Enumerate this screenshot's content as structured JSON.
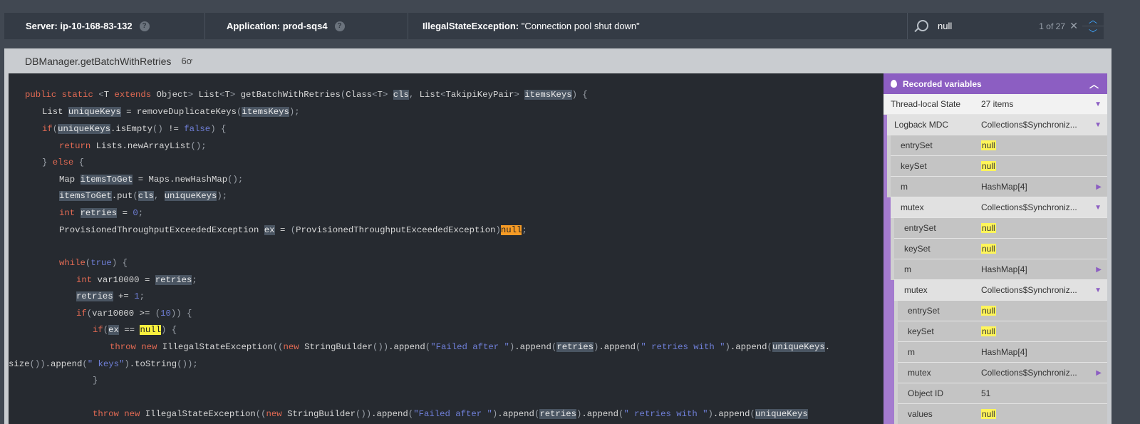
{
  "header": {
    "server": "Server: ip-10-168-83-132",
    "application": "Application: prod-sqs4",
    "exception_type": "IllegalStateException:",
    "exception_message": "\"Connection pool shut down\"",
    "help_glyph": "?",
    "search_value": "null",
    "match_count": "1 of 27",
    "clear_glyph": "✕",
    "prev_glyph": "︿",
    "next_glyph": "﹀"
  },
  "panel": {
    "method_title": "DBManager.getBatchWithRetries",
    "glasses_glyph": "6ơ"
  },
  "variables": {
    "title": "Recorded variables",
    "collapse_glyph": "︿",
    "rows": [
      {
        "name": "Thread-local State",
        "value": "27 items",
        "arrow": "down"
      },
      {
        "name": "Logback MDC",
        "value": "Collections$Synchroniz...",
        "arrow": "down"
      },
      {
        "name": "entrySet",
        "value": "null",
        "null": true
      },
      {
        "name": "keySet",
        "value": "null",
        "null": true
      },
      {
        "name": "m",
        "value": "HashMap[4]",
        "arrow": "right"
      },
      {
        "name": "mutex",
        "value": "Collections$Synchroniz...",
        "arrow": "down"
      },
      {
        "name": "entrySet",
        "value": "null",
        "null": true
      },
      {
        "name": "keySet",
        "value": "null",
        "null": true
      },
      {
        "name": "m",
        "value": "HashMap[4]",
        "arrow": "right"
      },
      {
        "name": "mutex",
        "value": "Collections$Synchroniz...",
        "arrow": "down"
      },
      {
        "name": "entrySet",
        "value": "null",
        "null": true
      },
      {
        "name": "keySet",
        "value": "null",
        "null": true
      },
      {
        "name": "m",
        "value": "HashMap[4]"
      },
      {
        "name": "mutex",
        "value": "Collections$Synchroniz...",
        "arrow": "right"
      },
      {
        "name": "Object ID",
        "value": "51"
      },
      {
        "name": "values",
        "value": "null",
        "null": true
      }
    ]
  },
  "code": {
    "lines": [
      [
        [
          "kw",
          "public static "
        ],
        [
          "pn",
          "<"
        ],
        [
          "t",
          "T "
        ],
        [
          "kw",
          "extends "
        ],
        [
          "t",
          "Object"
        ],
        [
          "pn",
          "> "
        ],
        [
          "t",
          "List"
        ],
        [
          "pn",
          "<"
        ],
        [
          "t",
          "T"
        ],
        [
          "pn",
          "> "
        ],
        [
          "t",
          "getBatchWithRetries"
        ],
        [
          "pn",
          "("
        ],
        [
          "t",
          "Class"
        ],
        [
          "pn",
          "<"
        ],
        [
          "t",
          "T"
        ],
        [
          "pn",
          "> "
        ],
        [
          "var",
          "cls"
        ],
        [
          "pn",
          ", "
        ],
        [
          "t",
          "List"
        ],
        [
          "pn",
          "<"
        ],
        [
          "t",
          "TakipiKeyPair"
        ],
        [
          "pn",
          "> "
        ],
        [
          "var",
          "itemsKeys"
        ],
        [
          "pn",
          ") {"
        ]
      ],
      [
        [
          "t",
          "List "
        ],
        [
          "var",
          "uniqueKeys"
        ],
        [
          "t",
          " = removeDuplicateKeys"
        ],
        [
          "pn",
          "("
        ],
        [
          "var",
          "itemsKeys"
        ],
        [
          "pn",
          ");"
        ]
      ],
      [
        [
          "kw",
          "if"
        ],
        [
          "pn",
          "("
        ],
        [
          "var",
          "uniqueKeys"
        ],
        [
          "t",
          ".isEmpty"
        ],
        [
          "pn",
          "() "
        ],
        [
          "t",
          "!= "
        ],
        [
          "lit",
          "false"
        ],
        [
          "pn",
          ") {"
        ]
      ],
      [
        [
          "kw",
          "return "
        ],
        [
          "t",
          "Lists.newArrayList"
        ],
        [
          "pn",
          "();"
        ]
      ],
      [
        [
          "pn",
          "} "
        ],
        [
          "kw",
          "else "
        ],
        [
          "pn",
          "{"
        ]
      ],
      [
        [
          "t",
          "Map "
        ],
        [
          "var",
          "itemsToGet"
        ],
        [
          "t",
          " = Maps.newHashMap"
        ],
        [
          "pn",
          "();"
        ]
      ],
      [
        [
          "var",
          "itemsToGet"
        ],
        [
          "t",
          ".put"
        ],
        [
          "pn",
          "("
        ],
        [
          "var",
          "cls"
        ],
        [
          "pn",
          ", "
        ],
        [
          "var",
          "uniqueKeys"
        ],
        [
          "pn",
          ");"
        ]
      ],
      [
        [
          "kw",
          "int "
        ],
        [
          "var",
          "retries"
        ],
        [
          "t",
          " = "
        ],
        [
          "lit",
          "0"
        ],
        [
          "pn",
          ";"
        ]
      ],
      [
        [
          "t",
          "ProvisionedThroughputExceededException "
        ],
        [
          "var",
          "ex"
        ],
        [
          "t",
          " = "
        ],
        [
          "pn",
          "("
        ],
        [
          "t",
          "ProvisionedThroughputExceededException"
        ],
        [
          "pn",
          ")"
        ],
        [
          "hlc",
          "null"
        ],
        [
          "pn",
          ";"
        ]
      ],
      [],
      [
        [
          "kw",
          "while"
        ],
        [
          "pn",
          "("
        ],
        [
          "lit",
          "true"
        ],
        [
          "pn",
          ") {"
        ]
      ],
      [
        [
          "kw",
          "int "
        ],
        [
          "t",
          "var10000 = "
        ],
        [
          "var",
          "retries"
        ],
        [
          "pn",
          ";"
        ]
      ],
      [
        [
          "var",
          "retries"
        ],
        [
          "t",
          " += "
        ],
        [
          "lit",
          "1"
        ],
        [
          "pn",
          ";"
        ]
      ],
      [
        [
          "kw",
          "if"
        ],
        [
          "pn",
          "("
        ],
        [
          "t",
          "var10000 >= "
        ],
        [
          "pn",
          "("
        ],
        [
          "lit",
          "10"
        ],
        [
          "pn",
          ")) {"
        ]
      ],
      [
        [
          "kw",
          "if"
        ],
        [
          "pn",
          "("
        ],
        [
          "var",
          "ex"
        ],
        [
          "t",
          " == "
        ],
        [
          "hl",
          "null"
        ],
        [
          "pn",
          ") {"
        ]
      ],
      [
        [
          "kw",
          "throw new "
        ],
        [
          "t",
          "IllegalStateException"
        ],
        [
          "pn",
          "(("
        ],
        [
          "kw",
          "new "
        ],
        [
          "t",
          "StringBuilder"
        ],
        [
          "pn",
          "())"
        ],
        [
          "t",
          ".append"
        ],
        [
          "pn",
          "("
        ],
        [
          "str",
          "\"Failed after \""
        ],
        [
          "pn",
          ")"
        ],
        [
          "t",
          ".append"
        ],
        [
          "pn",
          "("
        ],
        [
          "var",
          "retries"
        ],
        [
          "pn",
          ")"
        ],
        [
          "t",
          ".append"
        ],
        [
          "pn",
          "("
        ],
        [
          "str",
          "\" retries with \""
        ],
        [
          "pn",
          ")"
        ],
        [
          "t",
          ".append"
        ],
        [
          "pn",
          "("
        ],
        [
          "var",
          "uniqueKeys"
        ],
        [
          "t",
          "."
        ]
      ],
      [
        [
          "t",
          "size"
        ],
        [
          "pn",
          "())"
        ],
        [
          "t",
          ".append"
        ],
        [
          "pn",
          "("
        ],
        [
          "str",
          "\" keys\""
        ],
        [
          "pn",
          ")"
        ],
        [
          "t",
          ".toString"
        ],
        [
          "pn",
          "());"
        ]
      ],
      [
        [
          "pn",
          "}"
        ]
      ],
      [],
      [
        [
          "kw",
          "throw new "
        ],
        [
          "t",
          "IllegalStateException"
        ],
        [
          "pn",
          "(("
        ],
        [
          "kw",
          "new "
        ],
        [
          "t",
          "StringBuilder"
        ],
        [
          "pn",
          "())"
        ],
        [
          "t",
          ".append"
        ],
        [
          "pn",
          "("
        ],
        [
          "str",
          "\"Failed after \""
        ],
        [
          "pn",
          ")"
        ],
        [
          "t",
          ".append"
        ],
        [
          "pn",
          "("
        ],
        [
          "var",
          "retries"
        ],
        [
          "pn",
          ")"
        ],
        [
          "t",
          ".append"
        ],
        [
          "pn",
          "("
        ],
        [
          "str",
          "\" retries with \""
        ],
        [
          "pn",
          ")"
        ],
        [
          "t",
          ".append"
        ],
        [
          "pn",
          "("
        ],
        [
          "var",
          "uniqueKeys"
        ]
      ]
    ]
  }
}
